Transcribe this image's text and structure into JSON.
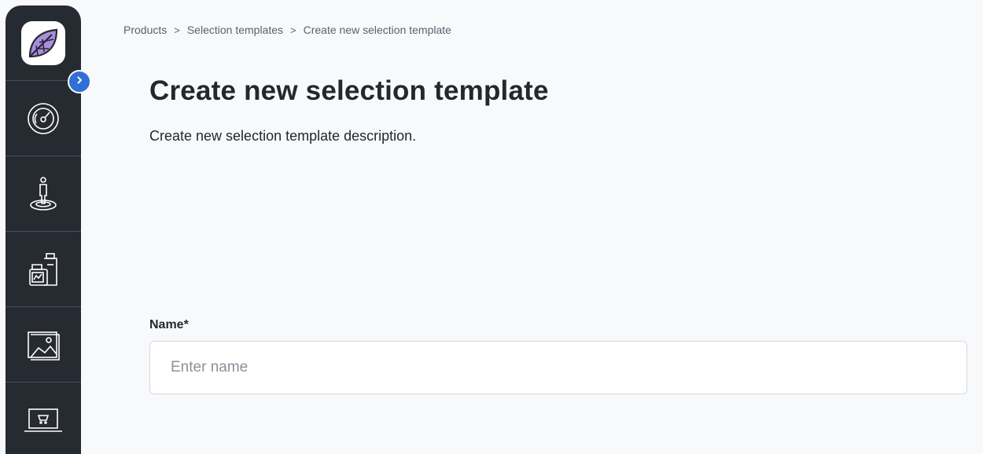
{
  "sidebar": {
    "items": [
      {
        "name": "dashboard",
        "icon": "speedometer-icon"
      },
      {
        "name": "customers",
        "icon": "person-on-target-icon"
      },
      {
        "name": "products",
        "icon": "product-bottles-icon"
      },
      {
        "name": "media",
        "icon": "image-gallery-icon"
      },
      {
        "name": "shop",
        "icon": "laptop-cart-icon"
      }
    ],
    "logo_icon": "leaf-logo-icon",
    "toggle_icon": "chevron-right-icon"
  },
  "breadcrumb": {
    "items": [
      "Products",
      "Selection templates"
    ],
    "separator": ">",
    "current": "Create new selection template"
  },
  "header": {
    "title": "Create new selection template",
    "description": "Create new selection template description."
  },
  "form": {
    "name": {
      "label": "Name*",
      "value": "",
      "placeholder": "Enter name"
    }
  },
  "colors": {
    "sidebar_bg": "#262a31",
    "accent": "#2f6fd6",
    "logo_purple": "#a98ee0",
    "page_bg": "#f8f9fb"
  }
}
